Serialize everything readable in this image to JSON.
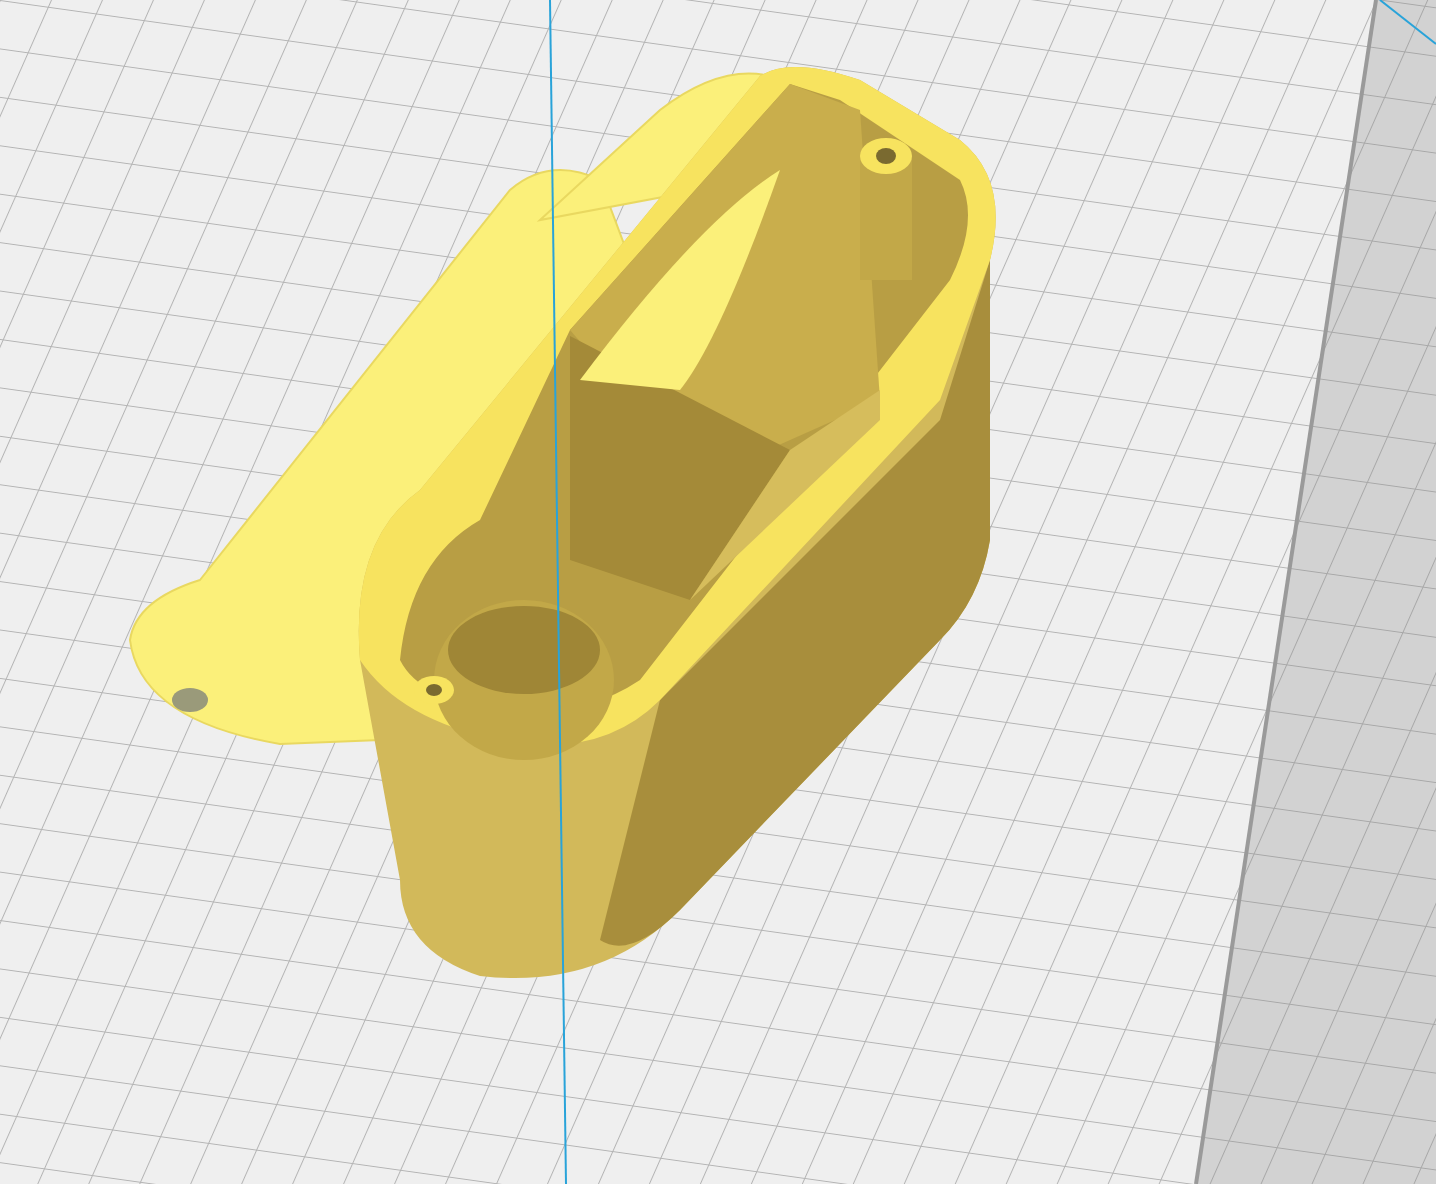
{
  "viewport": {
    "kind": "build-plate-3d"
  }
}
